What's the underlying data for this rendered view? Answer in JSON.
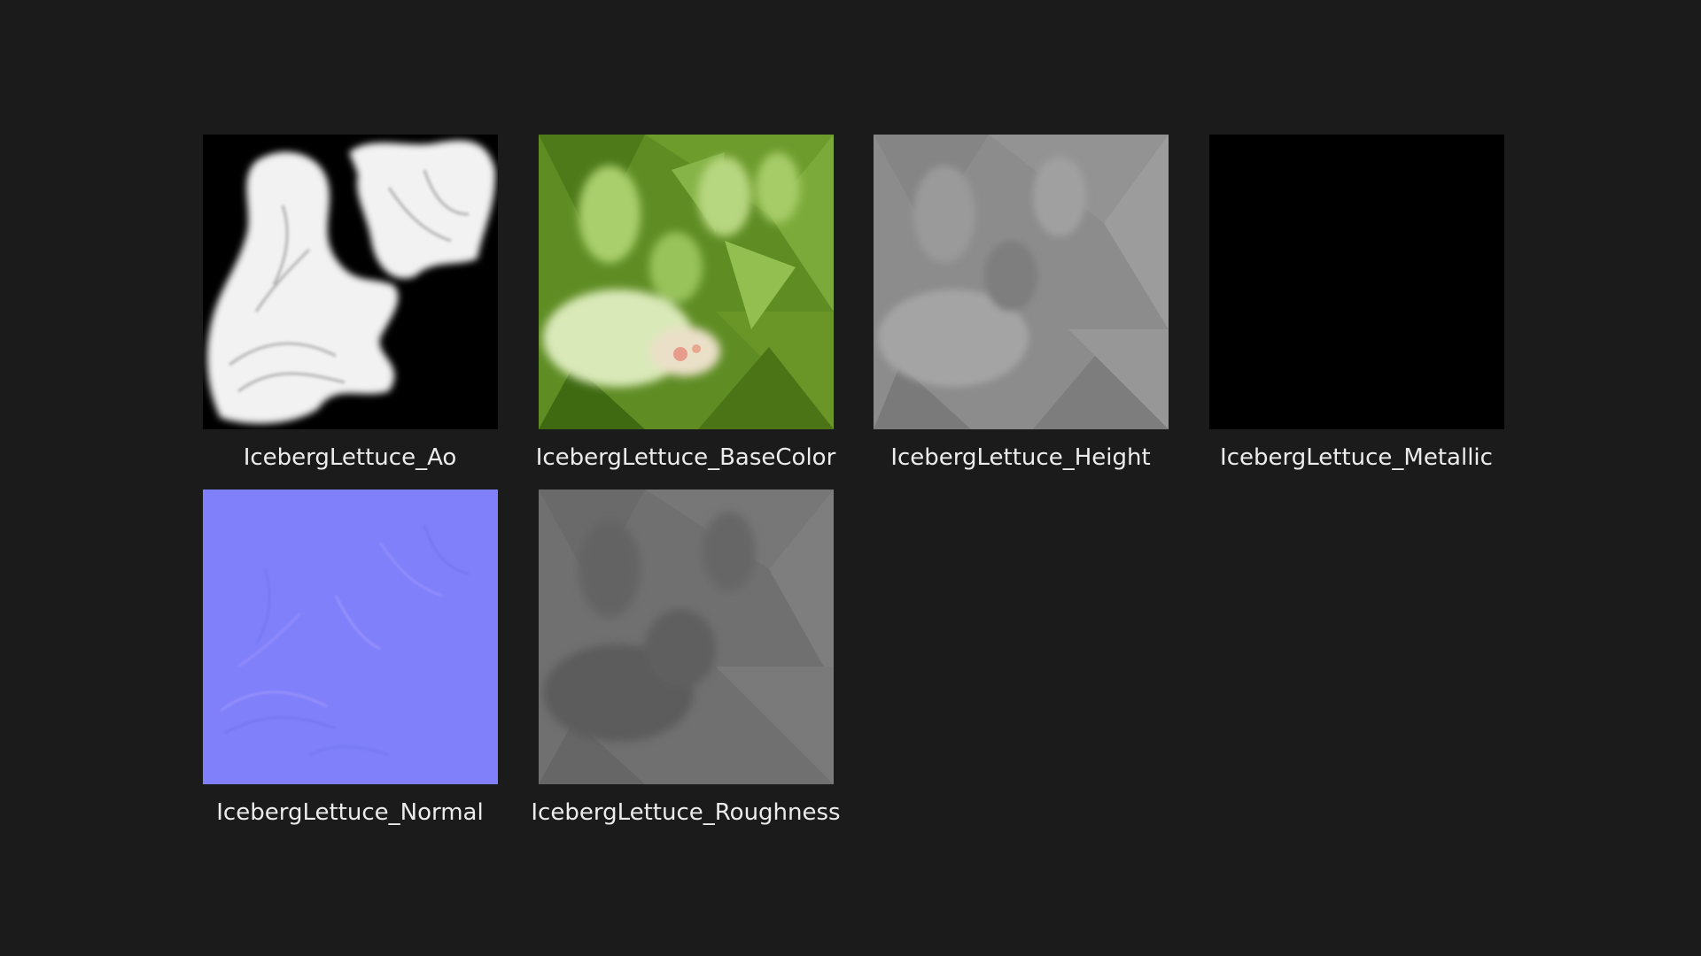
{
  "window": {
    "background": "#1b1b1b"
  },
  "files": [
    {
      "name": "IcebergLettuce_Ao",
      "icon": "ao-texture-thumbnail"
    },
    {
      "name": "IcebergLettuce_BaseColor",
      "icon": "basecolor-texture-thumbnail"
    },
    {
      "name": "IcebergLettuce_Height",
      "icon": "height-texture-thumbnail"
    },
    {
      "name": "IcebergLettuce_Metallic",
      "icon": "metallic-texture-thumbnail"
    },
    {
      "name": "IcebergLettuce_Normal",
      "icon": "normal-texture-thumbnail"
    },
    {
      "name": "IcebergLettuce_Roughness",
      "icon": "roughness-texture-thumbnail"
    }
  ]
}
